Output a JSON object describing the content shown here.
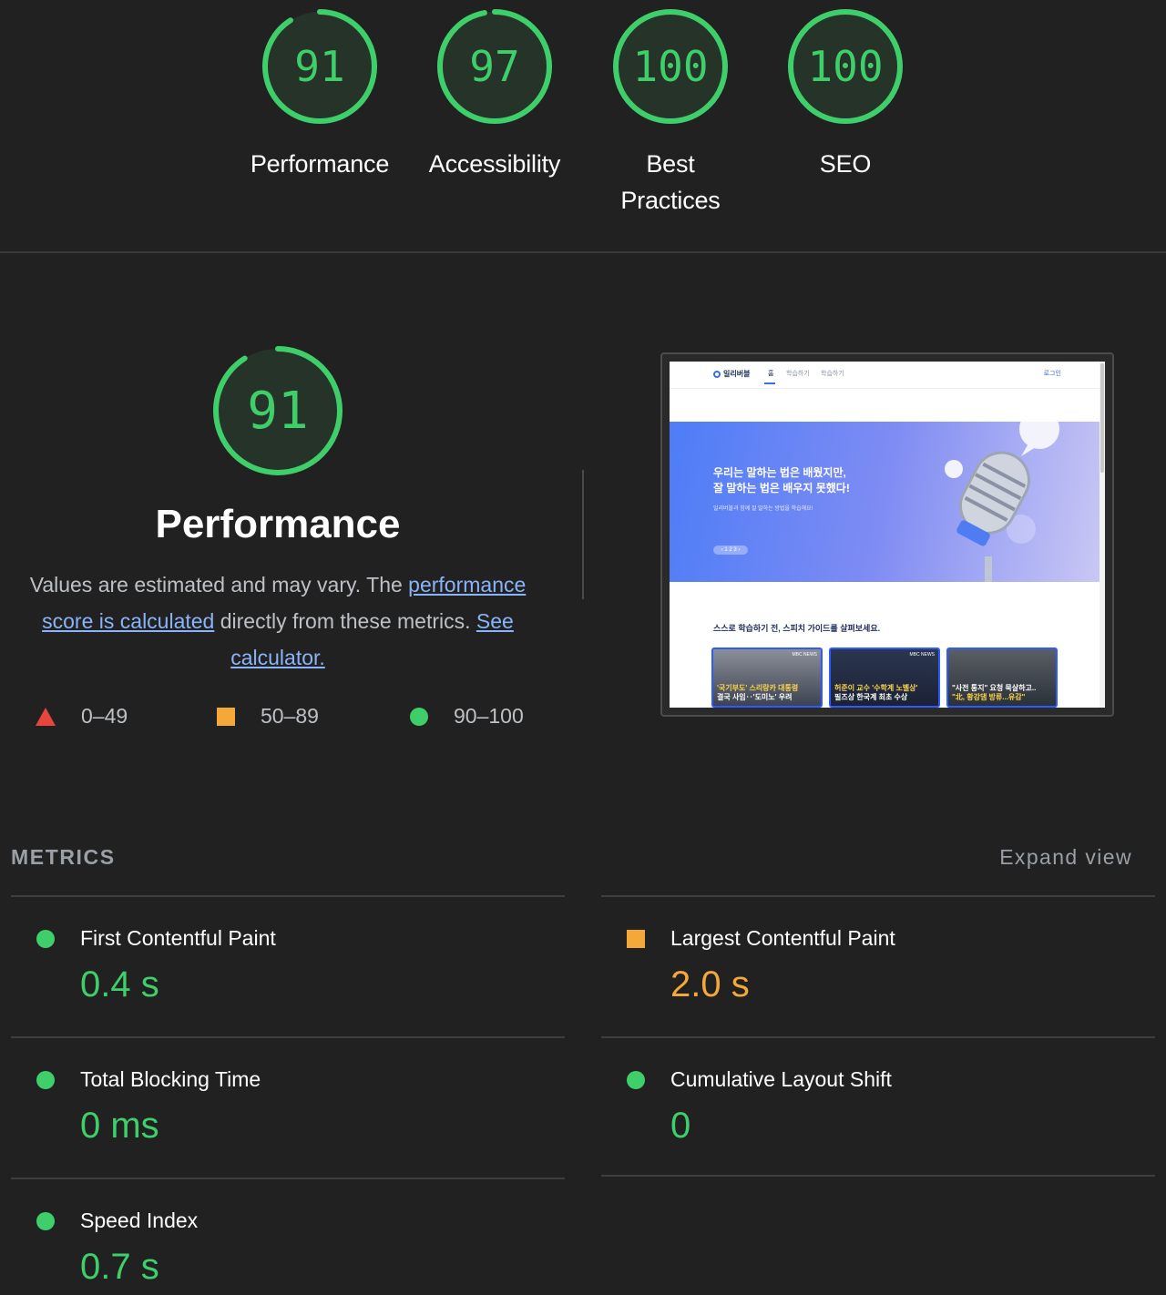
{
  "colors": {
    "pass": "#3ecf6a",
    "average": "#f4a83a",
    "fail": "#e8453c",
    "link": "#8ab4f8"
  },
  "gauges": [
    {
      "score": "91",
      "label": "Performance",
      "fraction": 0.91
    },
    {
      "score": "97",
      "label": "Accessibility",
      "fraction": 0.97
    },
    {
      "score": "100",
      "label": "Best Practices",
      "label_line1": "Best",
      "label_line2": "Practices",
      "fraction": 1.0
    },
    {
      "score": "100",
      "label": "SEO",
      "fraction": 1.0
    }
  ],
  "performance": {
    "score": "91",
    "fraction": 0.91,
    "title": "Performance",
    "desc_prefix": "Values are estimated and may vary. The ",
    "link1": "performance score is calculated",
    "desc_mid": " directly from these metrics. ",
    "link2": "See calculator.",
    "legend": [
      {
        "shape": "triangle-icon",
        "range": "0–49"
      },
      {
        "shape": "square-icon",
        "range": "50–89"
      },
      {
        "shape": "circle-icon",
        "range": "90–100"
      }
    ]
  },
  "screenshot": {
    "brand": "일리버블",
    "nav": [
      "홈",
      "학습하기",
      "학습하기"
    ],
    "login": "로그인",
    "hero_title": "우리는 말하는 법은 배웠지만,\n잘 말하는 법은 배우지 못했다!",
    "hero_sub": "일리버블과 함께 잘 말하는 방법을 학습해요!",
    "pager": "‹ 1 2 3 ›",
    "guide_title": "스스로 학습하기 전, 스피치 가이드를 살펴보세요.",
    "cards": [
      {
        "line1": "'국기부도' 스리랑카 대통령",
        "line2": "결국 사임‥'도미노' 우려",
        "badge": "MBC NEWS"
      },
      {
        "line1": "허준이 교수 '수학계 노벨상'",
        "line2": "필즈상 한국계 최초 수상",
        "badge": "MBC NEWS"
      },
      {
        "line1": "\"사전 통지\" 요청 묵살하고..",
        "line2": "\"北, 황강댐 방류...유감\"",
        "badge": ""
      }
    ]
  },
  "metrics": {
    "label": "METRICS",
    "expand": "Expand view",
    "items": [
      {
        "name": "First Contentful Paint",
        "value": "0.4 s",
        "status": "pass"
      },
      {
        "name": "Largest Contentful Paint",
        "value": "2.0 s",
        "status": "average"
      },
      {
        "name": "Total Blocking Time",
        "value": "0 ms",
        "status": "pass"
      },
      {
        "name": "Cumulative Layout Shift",
        "value": "0",
        "status": "pass"
      },
      {
        "name": "Speed Index",
        "value": "0.7 s",
        "status": "pass"
      }
    ]
  }
}
